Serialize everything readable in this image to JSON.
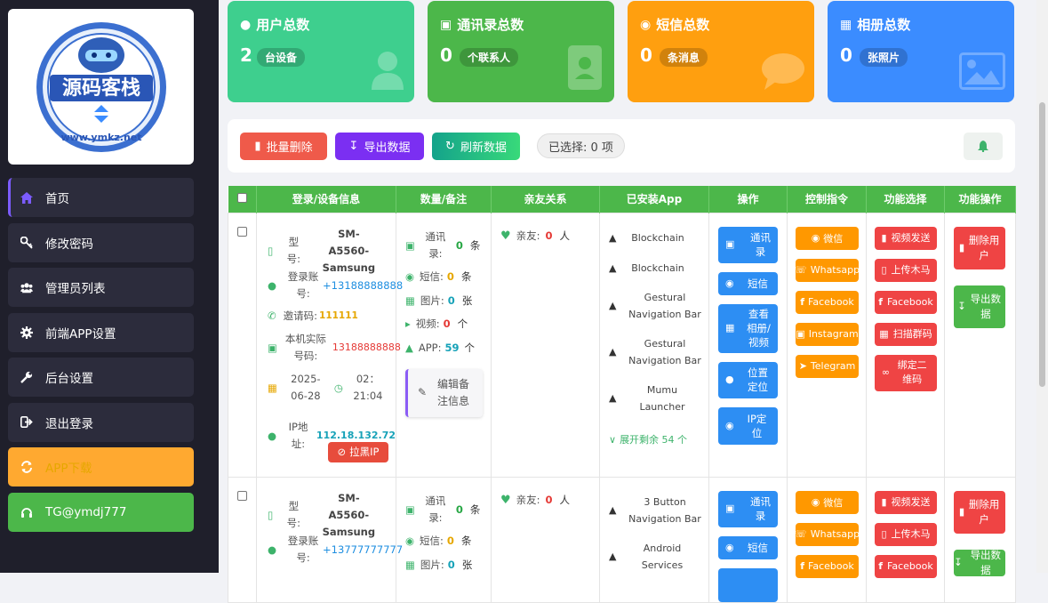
{
  "brand": {
    "logo_text": "源码客栈",
    "logo_url": "www.ymkz.net"
  },
  "sidebar": {
    "items": [
      {
        "label": "首页",
        "icon": "home-icon"
      },
      {
        "label": "修改密码",
        "icon": "key-icon"
      },
      {
        "label": "管理员列表",
        "icon": "users-icon"
      },
      {
        "label": "前端APP设置",
        "icon": "gear-icon"
      },
      {
        "label": "后台设置",
        "icon": "wrench-icon"
      },
      {
        "label": "退出登录",
        "icon": "logout-icon"
      },
      {
        "label": "APP下载",
        "icon": "refresh-icon"
      },
      {
        "label": "TG@ymdj777",
        "icon": "headset-icon"
      }
    ]
  },
  "stats": [
    {
      "title": "用户总数",
      "value": "2",
      "unit": "台设备",
      "color": "#3ecf8e"
    },
    {
      "title": "通讯录总数",
      "value": "0",
      "unit": "个联系人",
      "color": "#4cb74a"
    },
    {
      "title": "短信总数",
      "value": "0",
      "unit": "条消息",
      "color": "#ff9f0f"
    },
    {
      "title": "相册总数",
      "value": "0",
      "unit": "张照片",
      "color": "#3b8cff"
    }
  ],
  "toolbar": {
    "batch_delete": "批量删除",
    "export": "导出数据",
    "refresh": "刷新数据",
    "selected": "已选择: 0 项"
  },
  "table": {
    "headers": [
      "登录/设备信息",
      "数量/备注",
      "亲友关系",
      "已安装App",
      "操作",
      "控制指令",
      "功能选择",
      "功能操作"
    ],
    "labels": {
      "model": "型号:",
      "account": "登录账号:",
      "invite": "邀请码:",
      "phone": "本机实际号码:",
      "ip": "IP地址:",
      "block_ip": "拉黑IP",
      "contacts": "通讯录:",
      "sms": "短信:",
      "photos": "图片:",
      "video": "视频:",
      "app": "APP:",
      "edit_note": "编辑备注信息",
      "friends": "亲友:",
      "friends_unit": "人",
      "unit_tiao": "条",
      "unit_zhang": "张",
      "unit_ge": "个",
      "expand": "展开剩余 54 个"
    },
    "rows": [
      {
        "model": "SM-A5560-Samsung",
        "account": "+13188888888",
        "invite": "111111",
        "phone": "13188888888",
        "date": "2025-06-28",
        "time": "02：21:04",
        "ip": "112.18.132.72",
        "contacts": "0",
        "sms": "0",
        "photos": "0",
        "video": "0",
        "apps_count": "59",
        "friends": "0",
        "apps": [
          "Blockchain",
          "Blockchain",
          "Gestural Navigation Bar",
          "Gestural Navigation Bar",
          "Mumu Launcher"
        ]
      },
      {
        "model": "SM-A5560-Samsung",
        "account": "+13777777777",
        "contacts": "0",
        "sms": "0",
        "photos": "0",
        "friends": "0",
        "apps": [
          "3 Button Navigation Bar",
          "Android Services"
        ]
      }
    ],
    "actions": [
      "通讯录",
      "短信",
      "查看相册/视频",
      "位置定位",
      "IP定位"
    ],
    "controls": [
      "微信",
      "Whatsapp",
      "Facebook",
      "Instagram",
      "Telegram"
    ],
    "functions": [
      "视频发送",
      "上传木马",
      "Facebook",
      "扫描群码",
      "绑定二维码"
    ],
    "ops": [
      "删除用户",
      "导出数据"
    ]
  }
}
